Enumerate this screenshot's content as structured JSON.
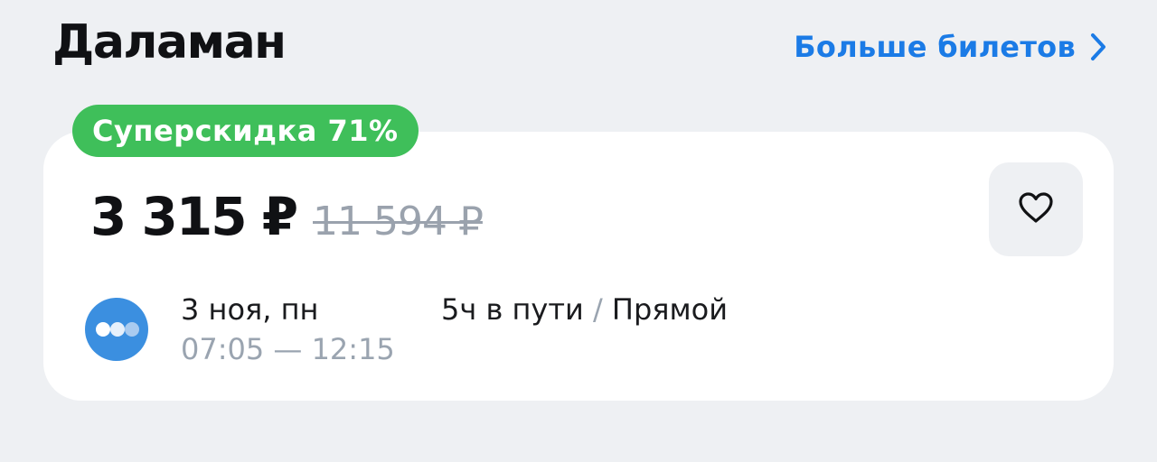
{
  "header": {
    "title": "Даламан",
    "more_tickets_label": "Больше билетов"
  },
  "offer": {
    "badge": "Суперскидка 71%",
    "price": "3 315 ₽",
    "old_price": "11 594 ₽",
    "flight": {
      "date": "3 ноя, пн",
      "times": "07:05 — 12:15",
      "duration": "5ч в пути",
      "separator": "/",
      "type": "Прямой"
    }
  },
  "colors": {
    "background": "#eef0f3",
    "accent_link": "#1b7be6",
    "badge_green": "#3fbf5a",
    "airline_logo_blue": "#3b8fe0"
  },
  "icons": {
    "more_link": "chevron-right-icon",
    "favorite": "heart-outline-icon",
    "airline": "airline-logo-dots"
  }
}
